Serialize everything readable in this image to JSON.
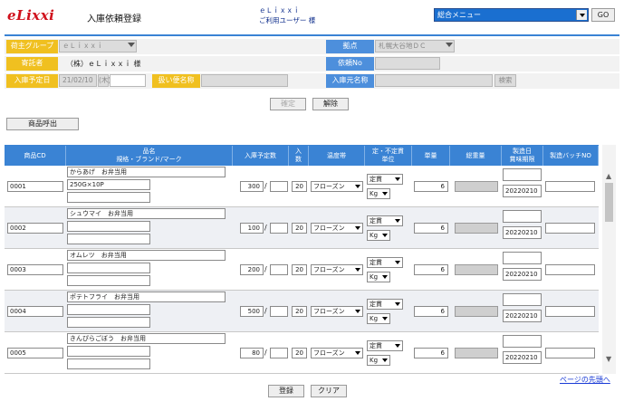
{
  "header": {
    "logo": "eLixxi",
    "page_title": "入庫依頼登録",
    "user_company": "ｅＬｉｘｘｉ",
    "user_label": "ご利用ユーザー 様",
    "menu_select": "総合メニュー",
    "go_label": "GO"
  },
  "form": {
    "shipper_group_label": "荷主グループ",
    "shipper_group_value": "ｅＬｉｘｘｉ",
    "depositor_label": "寄託者",
    "depositor_value": "（株）ｅＬｉｘｘｉ 様",
    "arrival_date_label": "入庫予定日",
    "arrival_date_value": "21/02/10",
    "arrival_date_day": "(木)",
    "consignor_label": "扱い便名称",
    "base_label": "拠点",
    "base_value": "札幌大谷地ＤＣ",
    "request_no_label": "依頼No",
    "source_label": "入庫元名称",
    "search_label": "検索",
    "confirm_label": "確定",
    "release_label": "解除",
    "product_call_label": "商品呼出"
  },
  "table": {
    "headers": {
      "code": "商品CD",
      "name_l1": "品名",
      "name_l2": "規格・ブランド/マーク",
      "qty": "入庫予定数",
      "case_l1": "入",
      "case_l2": "数",
      "temp": "温度帯",
      "unit_l1": "定・不定貫",
      "unit_l2": "単位",
      "price": "単量",
      "total": "総重量",
      "date_l1": "製造日",
      "date_l2": "賞味期限",
      "batch": "製造バッチNO"
    },
    "rows": [
      {
        "code": "0001",
        "name": "からあげ　お弁当用",
        "spec": "250G×10P",
        "qty": "300",
        "case": "20",
        "temp": "フローズン",
        "unit": "定貫",
        "uom": "Kg",
        "price": "6",
        "date": "20220210"
      },
      {
        "code": "0002",
        "name": "シュウマイ　お弁当用",
        "spec": "",
        "qty": "100",
        "case": "20",
        "temp": "フローズン",
        "unit": "定貫",
        "uom": "Kg",
        "price": "6",
        "date": "20220210"
      },
      {
        "code": "0003",
        "name": "オムレツ　お弁当用",
        "spec": "",
        "qty": "200",
        "case": "20",
        "temp": "フローズン",
        "unit": "定貫",
        "uom": "Kg",
        "price": "6",
        "date": "20220210"
      },
      {
        "code": "0004",
        "name": "ポテトフライ　お弁当用",
        "spec": "",
        "qty": "500",
        "case": "20",
        "temp": "フローズン",
        "unit": "定貫",
        "uom": "Kg",
        "price": "6",
        "date": "20220210"
      },
      {
        "code": "0005",
        "name": "きんぴらごぼう　お弁当用",
        "spec": "",
        "qty": "80",
        "case": "20",
        "temp": "フローズン",
        "unit": "定貫",
        "uom": "Kg",
        "price": "6",
        "date": "20220210"
      }
    ]
  },
  "footer": {
    "register_label": "登録",
    "clear_label": "クリア",
    "page_top_link": "ページの先頭へ"
  },
  "colors": {
    "accent_blue": "#3a83d4",
    "label_yellow": "#f0c020",
    "logo_red": "#d0101c"
  }
}
